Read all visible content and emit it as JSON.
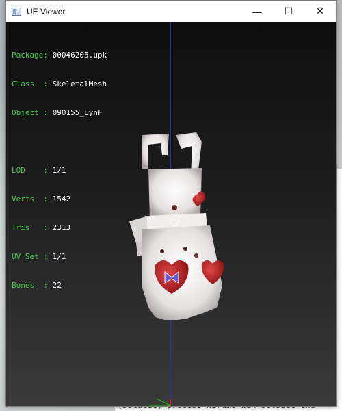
{
  "window": {
    "title": "UE Viewer",
    "controls": {
      "minimize": "—",
      "maximize": "☐",
      "close": "✕"
    }
  },
  "info": {
    "rows": [
      {
        "key": "Package: ",
        "value": "00046205.upk"
      },
      {
        "key": "Class  : ",
        "value": "SkeletalMesh"
      },
      {
        "key": "Object : ",
        "value": "090155_LynF"
      },
      {
        "key": "",
        "value": ""
      },
      {
        "key": "LOD    : ",
        "value": "1/1"
      },
      {
        "key": "Verts  : ",
        "value": "1542"
      },
      {
        "key": "Tris   : ",
        "value": "2313"
      },
      {
        "key": "UV Set : ",
        "value": "1/1"
      },
      {
        "key": "Bones  : ",
        "value": "22"
      }
    ]
  },
  "background_console": {
    "bottom_line": "[DStatic] process  Nirems win setSize  end"
  },
  "colors": {
    "info_key": "#3ecf45",
    "info_value": "#ffffff",
    "axis_vertical": "#2a2ad0",
    "viewport_bg": "#1b1b1b"
  },
  "icons": {
    "app": "ue-viewer-app-icon",
    "minimize": "minimize-icon",
    "maximize": "maximize-icon",
    "close": "close-icon"
  }
}
